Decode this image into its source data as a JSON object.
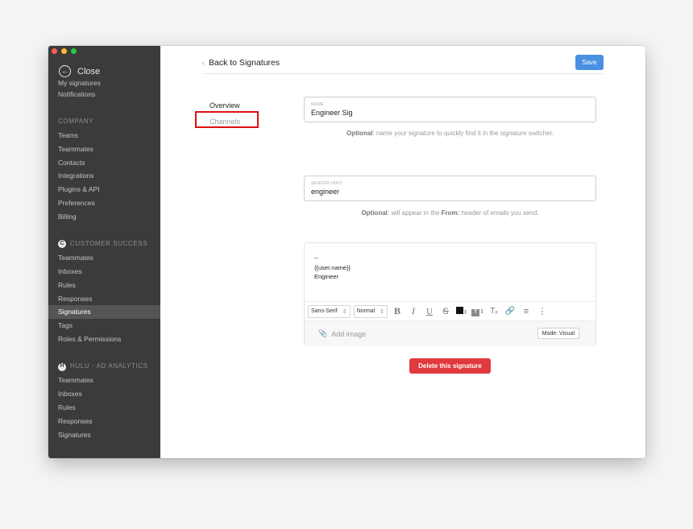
{
  "window": {
    "traffic_lights": [
      "#ff5f57",
      "#febc2e",
      "#28c840"
    ]
  },
  "sidebar": {
    "close_label": "Close",
    "top_items": [
      {
        "label": "My signatures"
      },
      {
        "label": "Notifications"
      }
    ],
    "company": {
      "header": "COMPANY",
      "items": [
        {
          "label": "Teams"
        },
        {
          "label": "Teammates"
        },
        {
          "label": "Contacts"
        },
        {
          "label": "Integrations"
        },
        {
          "label": "Plugins & API"
        },
        {
          "label": "Preferences"
        },
        {
          "label": "Billing"
        }
      ]
    },
    "customer_success": {
      "badge": "C",
      "header": "CUSTOMER SUCCESS",
      "items": [
        {
          "label": "Teammates"
        },
        {
          "label": "Inboxes"
        },
        {
          "label": "Rules"
        },
        {
          "label": "Responses"
        },
        {
          "label": "Signatures",
          "active": true
        },
        {
          "label": "Tags"
        },
        {
          "label": "Roles & Permissions"
        }
      ]
    },
    "hulu": {
      "badge": "H",
      "header": "HULU - AD ANALYTICS",
      "items": [
        {
          "label": "Teammates"
        },
        {
          "label": "Inboxes"
        },
        {
          "label": "Rules"
        },
        {
          "label": "Responses"
        },
        {
          "label": "Signatures"
        }
      ]
    }
  },
  "header": {
    "back_label": "Back to Signatures",
    "save_label": "Save"
  },
  "tabs": {
    "overview": "Overview",
    "channels": "Channels"
  },
  "name_field": {
    "label": "NAME",
    "value": "Engineer Sig",
    "hint_strong": "Optional",
    "hint_rest": ": name your signature to quickly find it in the signature switcher."
  },
  "sender_field": {
    "label": "SENDER INFO",
    "value": "engineer",
    "hint_strong": "Optional",
    "hint_mid": ": will appear in the ",
    "hint_from": "From:",
    "hint_end": " header of emails you send."
  },
  "editor": {
    "lines": [
      "--",
      "{{user.name}}",
      "Engineer"
    ],
    "font_select": "Sans-Serif",
    "size_select": "Normal",
    "add_image_label": "Add image",
    "mode_label": "Mode: Visual"
  },
  "delete_label": "Delete this signature",
  "colors": {
    "accent": "#4a90e2",
    "danger": "#e0393e",
    "highlight_box": "#e01010",
    "sidebar_bg": "#3b3b3b"
  }
}
